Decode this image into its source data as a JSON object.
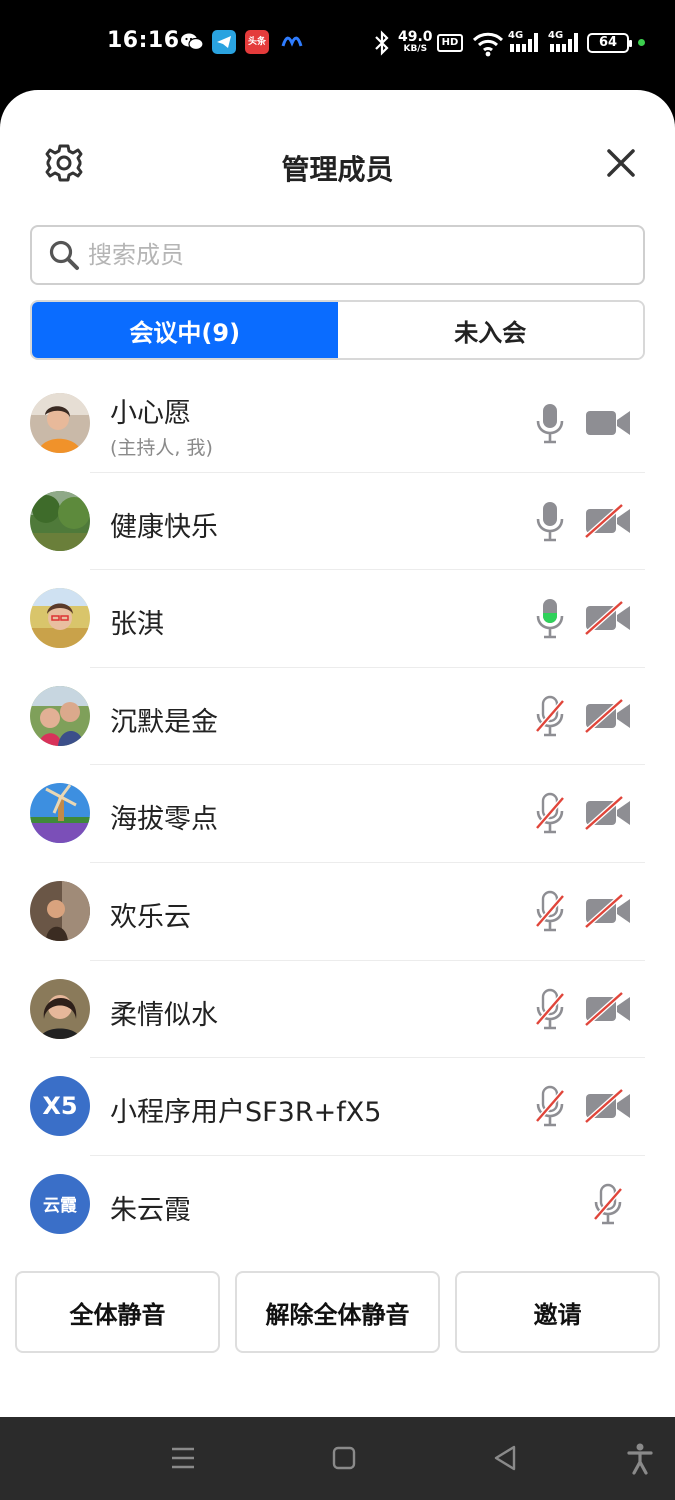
{
  "status": {
    "time": "16:16",
    "speed_value": "49.0",
    "speed_unit": "KB/S",
    "hd": "HD",
    "net1": "4G",
    "net2": "4G",
    "battery": "64",
    "toutiao": "头条",
    "icons": [
      "wechat-icon",
      "telegram-icon",
      "toutiao-icon",
      "meta-icon",
      "bluetooth-icon",
      "wifi-icon",
      "signal-icon",
      "battery-icon"
    ]
  },
  "sheet": {
    "title": "管理成员",
    "search_placeholder": "搜索成员",
    "tabs": [
      {
        "label": "会议中(9)",
        "active": true
      },
      {
        "label": "未入会",
        "active": false
      }
    ]
  },
  "members": [
    {
      "name": "小心愿",
      "role": "(主持人, 我)",
      "mic": "on",
      "cam": "on"
    },
    {
      "name": "健康快乐",
      "role": "",
      "mic": "on",
      "cam": "off"
    },
    {
      "name": "张淇",
      "role": "",
      "mic": "speaking",
      "cam": "off"
    },
    {
      "name": "沉默是金",
      "role": "",
      "mic": "off",
      "cam": "off"
    },
    {
      "name": "海拔零点",
      "role": "",
      "mic": "off",
      "cam": "off"
    },
    {
      "name": "欢乐云",
      "role": "",
      "mic": "off",
      "cam": "off"
    },
    {
      "name": "柔情似水",
      "role": "",
      "mic": "off",
      "cam": "off"
    },
    {
      "name": "小程序用户SF3R+fX5",
      "avatar_text": "X5",
      "role": "",
      "mic": "off",
      "cam": "off"
    },
    {
      "name": "朱云霞",
      "avatar_text": "云霞",
      "role": "",
      "mic": "off",
      "cam": "none"
    }
  ],
  "actions": {
    "mute_all": "全体静音",
    "unmute_all": "解除全体静音",
    "invite": "邀请"
  },
  "colors": {
    "accent": "#0a6cff",
    "icon_gray": "#8e8e93",
    "muted_red": "#e0453a",
    "speaking_green": "#2fd15a"
  }
}
